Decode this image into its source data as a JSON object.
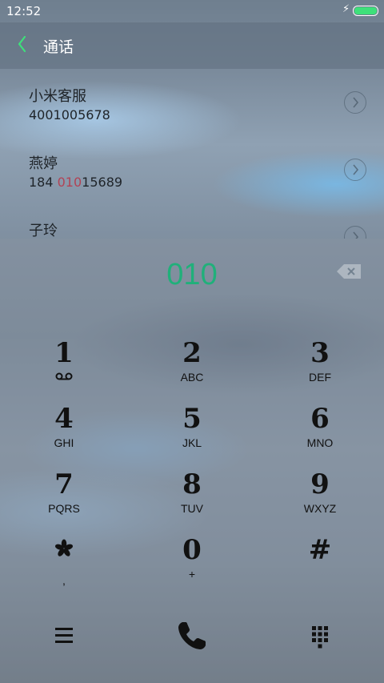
{
  "status": {
    "time": "12:52",
    "battery_color": "#3ee07a"
  },
  "header": {
    "title": "通话",
    "back_icon": "chevron-left-icon",
    "accent": "#3ee07a"
  },
  "contacts": [
    {
      "name": "小米客服",
      "number": "4001005678",
      "number_prefix": "4001005678",
      "number_match": "",
      "number_suffix": ""
    },
    {
      "name": "燕婷",
      "number": "184 01015689",
      "number_prefix": "184 ",
      "number_match": "010",
      "number_suffix": "15689"
    },
    {
      "name": "子玲",
      "number": "",
      "number_prefix": "",
      "number_match": "",
      "number_suffix": ""
    }
  ],
  "dialer": {
    "input": "010",
    "input_color": "#20b07a",
    "keys": [
      {
        "digit": "1",
        "letters": ""
      },
      {
        "digit": "2",
        "letters": "ABC"
      },
      {
        "digit": "3",
        "letters": "DEF"
      },
      {
        "digit": "4",
        "letters": "GHI"
      },
      {
        "digit": "5",
        "letters": "JKL"
      },
      {
        "digit": "6",
        "letters": "MNO"
      },
      {
        "digit": "7",
        "letters": "PQRS"
      },
      {
        "digit": "8",
        "letters": "TUV"
      },
      {
        "digit": "9",
        "letters": "WXYZ"
      },
      {
        "digit": "",
        "letters": ","
      },
      {
        "digit": "0",
        "letters": "+"
      },
      {
        "digit": "#",
        "letters": ""
      }
    ]
  },
  "bottom_bar": {
    "menu_icon": "menu-icon",
    "call_icon": "phone-icon",
    "keypad_icon": "keypad-icon"
  }
}
